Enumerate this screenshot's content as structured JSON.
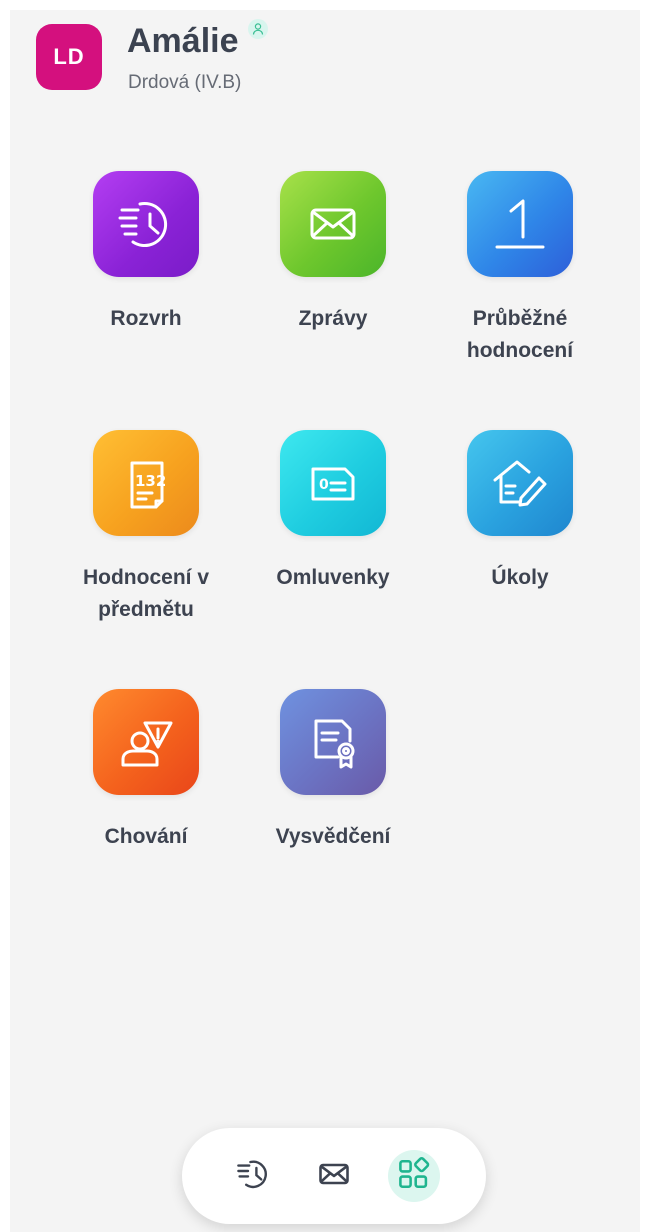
{
  "user": {
    "initials": "LD",
    "first_name": "Amálie",
    "subtitle": "Drdová (IV.B)",
    "avatar_color": "#d4107e"
  },
  "tiles": [
    {
      "label": "Rozvrh",
      "icon": "schedule-clock-icon"
    },
    {
      "label": "Zprávy",
      "icon": "envelope-icon"
    },
    {
      "label": "Průběžné hodnocení",
      "icon": "grade-one-icon"
    },
    {
      "label": "Hodnocení v předmětu",
      "icon": "subject-grades-document-icon"
    },
    {
      "label": "Omluvenky",
      "icon": "excuse-card-icon"
    },
    {
      "label": "Úkoly",
      "icon": "homework-house-pencil-icon"
    },
    {
      "label": "Chování",
      "icon": "behavior-warning-person-icon"
    },
    {
      "label": "Vysvědčení",
      "icon": "certificate-ribbon-icon"
    }
  ],
  "bottom_nav": [
    {
      "name": "schedule",
      "icon": "schedule-clock-icon",
      "active": false
    },
    {
      "name": "messages",
      "icon": "envelope-icon",
      "active": false
    },
    {
      "name": "apps",
      "icon": "apps-grid-icon",
      "active": true
    }
  ],
  "colors": {
    "background": "#f4f4f4",
    "accent": "#1fb58f",
    "text": "#3d4350"
  }
}
